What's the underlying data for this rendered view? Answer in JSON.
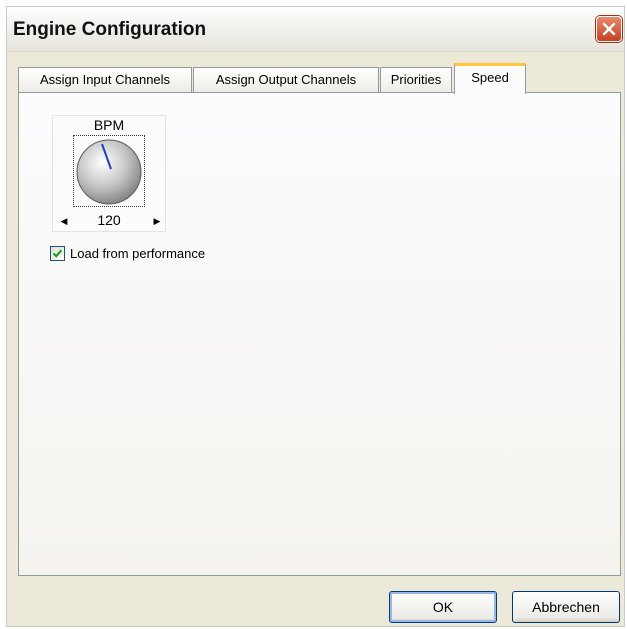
{
  "window": {
    "title": "Engine Configuration",
    "close_icon": "close-x-icon"
  },
  "tabs": [
    {
      "label": "Assign Input Channels",
      "active": false
    },
    {
      "label": "Assign Output Channels",
      "active": false
    },
    {
      "label": "Priorities",
      "active": false
    },
    {
      "label": "Speed",
      "active": true
    }
  ],
  "speed": {
    "knob_label": "BPM",
    "knob_value": "120",
    "decrease_icon": "arrow-left-icon",
    "increase_icon": "arrow-right-icon",
    "load_from_performance_label": "Load from performance",
    "load_from_performance_checked": true
  },
  "buttons": {
    "ok": "OK",
    "cancel": "Abbrechen"
  },
  "colors": {
    "active_tab_accent": "#ffc83c",
    "close_button": "#c84020",
    "needle": "#2040c0"
  }
}
